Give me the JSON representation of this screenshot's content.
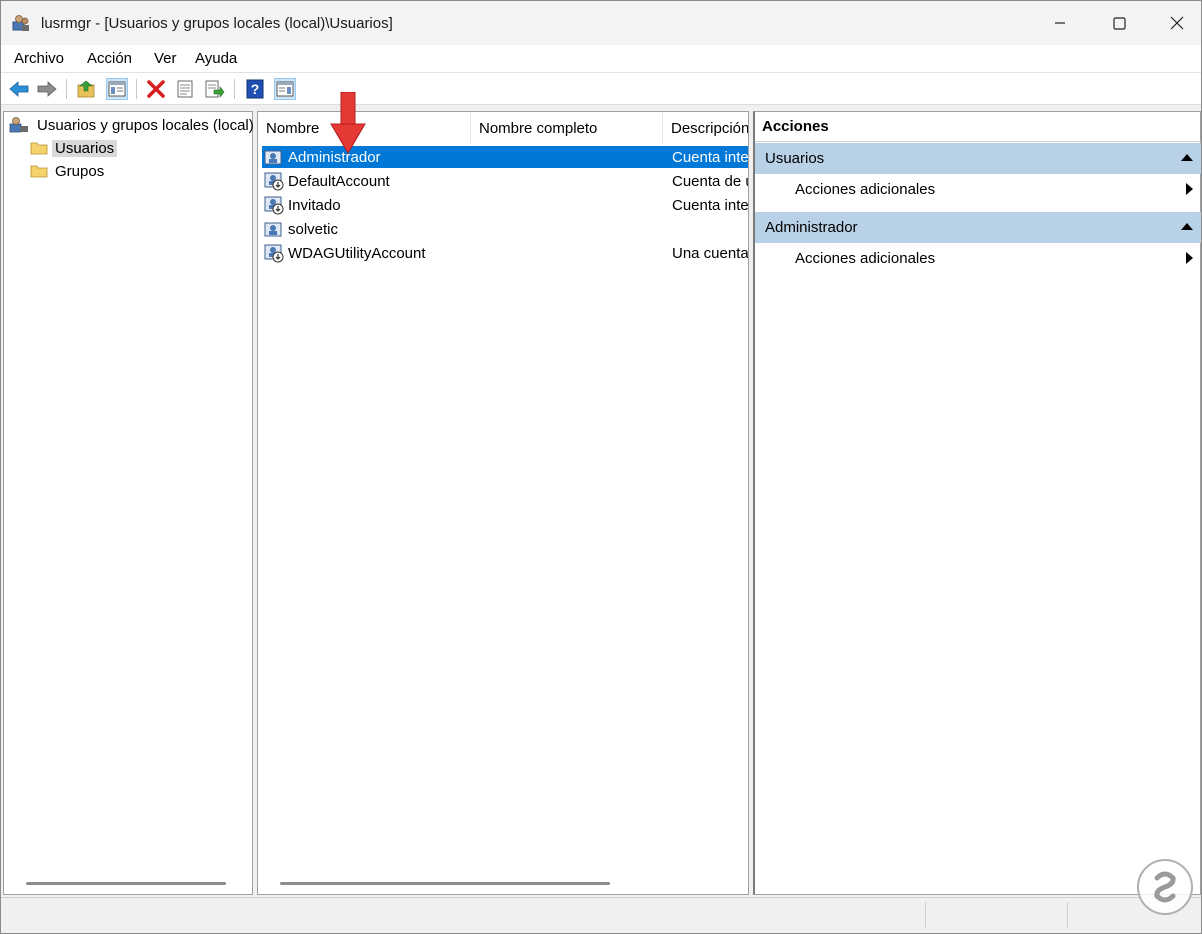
{
  "window": {
    "title": "lusrmgr - [Usuarios y grupos locales (local)\\Usuarios]"
  },
  "menu": [
    "Archivo",
    "Acción",
    "Ver",
    "Ayuda"
  ],
  "toolbar": {
    "icons": [
      "back-arrow-icon",
      "forward-arrow-icon",
      "up-folder-icon",
      "show-hide-tree-icon",
      "delete-icon",
      "properties-icon",
      "export-list-icon",
      "help-icon",
      "show-hide-action-pane-icon"
    ]
  },
  "tree": {
    "root": "Usuarios y grupos locales (local)",
    "children": [
      "Usuarios",
      "Grupos"
    ],
    "selected": "Usuarios"
  },
  "list": {
    "columns": [
      "Nombre",
      "Nombre completo",
      "Descripción"
    ],
    "rows": [
      {
        "name": "Administrador",
        "fullname": "",
        "description": "Cuenta integrada para la administración del equipo o dominio",
        "selected": true
      },
      {
        "name": "DefaultAccount",
        "fullname": "",
        "description": "Cuenta de usuario administrada por el sistema.",
        "selected": false
      },
      {
        "name": "Invitado",
        "fullname": "",
        "description": "Cuenta integrada para el acceso como invitado al equipo o dominio",
        "selected": false
      },
      {
        "name": "solvetic",
        "fullname": "",
        "description": "",
        "selected": false
      },
      {
        "name": "WDAGUtilityAccount",
        "fullname": "",
        "description": "Una cuenta de usuario que el sistema administra y usa para escenarios de Protección de aplicaciones de Windows Defender.",
        "selected": false
      }
    ]
  },
  "actions": {
    "header": "Acciones",
    "sections": [
      {
        "title": "Usuarios",
        "items": [
          "Acciones adicionales"
        ]
      },
      {
        "title": "Administrador",
        "items": [
          "Acciones adicionales"
        ]
      }
    ]
  },
  "colors": {
    "selection": "#0078d7",
    "section_header": "#b9d1e6",
    "annotation_arrow": "#e53935"
  }
}
